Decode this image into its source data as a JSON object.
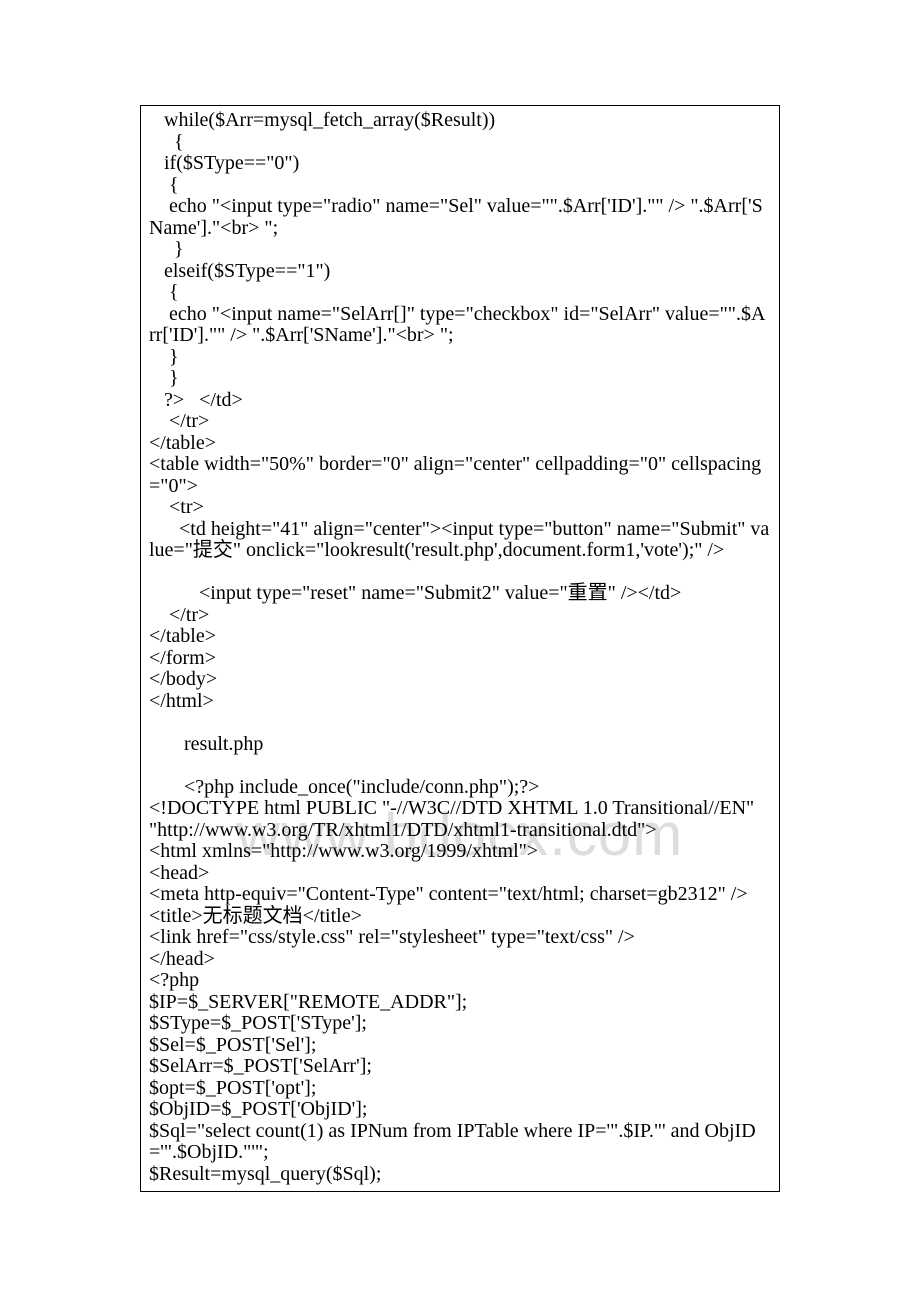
{
  "watermark": "www.bdocx.com",
  "lines": [
    "   while($Arr=mysql_fetch_array($Result))",
    "     {",
    "   if($SType==\"0\")",
    "    {",
    "    echo \"<input type=\"radio\" name=\"Sel\" value=\"\".$Arr['ID'].\"\" /> \".$Arr['SName'].\"<br> \";",
    "     }",
    "   elseif($SType==\"1\")",
    "    {",
    "    echo \"<input name=\"SelArr[]\" type=\"checkbox\" id=\"SelArr\" value=\"\".$Arr['ID'].\"\" /> \".$Arr['SName'].\"<br> \";",
    "    }",
    "    }",
    "   ?>   </td>",
    "    </tr>",
    "</table>",
    "<table width=\"50%\" border=\"0\" align=\"center\" cellpadding=\"0\" cellspacing=\"0\">",
    "    <tr>",
    "      <td height=\"41\" align=\"center\"><input type=\"button\" name=\"Submit\" value=\"提交\" onclick=\"lookresult('result.php',document.form1,'vote');\" />",
    "",
    "          <input type=\"reset\" name=\"Submit2\" value=\"重置\" /></td>",
    "    </tr>",
    "</table>",
    "</form>",
    "</body>",
    "</html>",
    "",
    "       result.php",
    "",
    "       <?php include_once(\"include/conn.php\");?>",
    "<!DOCTYPE html PUBLIC \"-//W3C//DTD XHTML 1.0 Transitional//EN\" \"http://www.w3.org/TR/xhtml1/DTD/xhtml1-transitional.dtd\">",
    "<html xmlns=\"http://www.w3.org/1999/xhtml\">",
    "<head>",
    "<meta http-equiv=\"Content-Type\" content=\"text/html; charset=gb2312\" />",
    "<title>无标题文档</title>",
    "<link href=\"css/style.css\" rel=\"stylesheet\" type=\"text/css\" />",
    "</head>",
    "<?php",
    "$IP=$_SERVER[\"REMOTE_ADDR\"];",
    "$SType=$_POST['SType'];",
    "$Sel=$_POST['Sel'];",
    "$SelArr=$_POST['SelArr'];",
    "$opt=$_POST['opt'];",
    "$ObjID=$_POST['ObjID'];",
    "$Sql=\"select count(1) as IPNum from IPTable where IP='\".$IP.\"' and ObjID='\".$ObjID.\"'\";",
    "$Result=mysql_query($Sql);"
  ]
}
